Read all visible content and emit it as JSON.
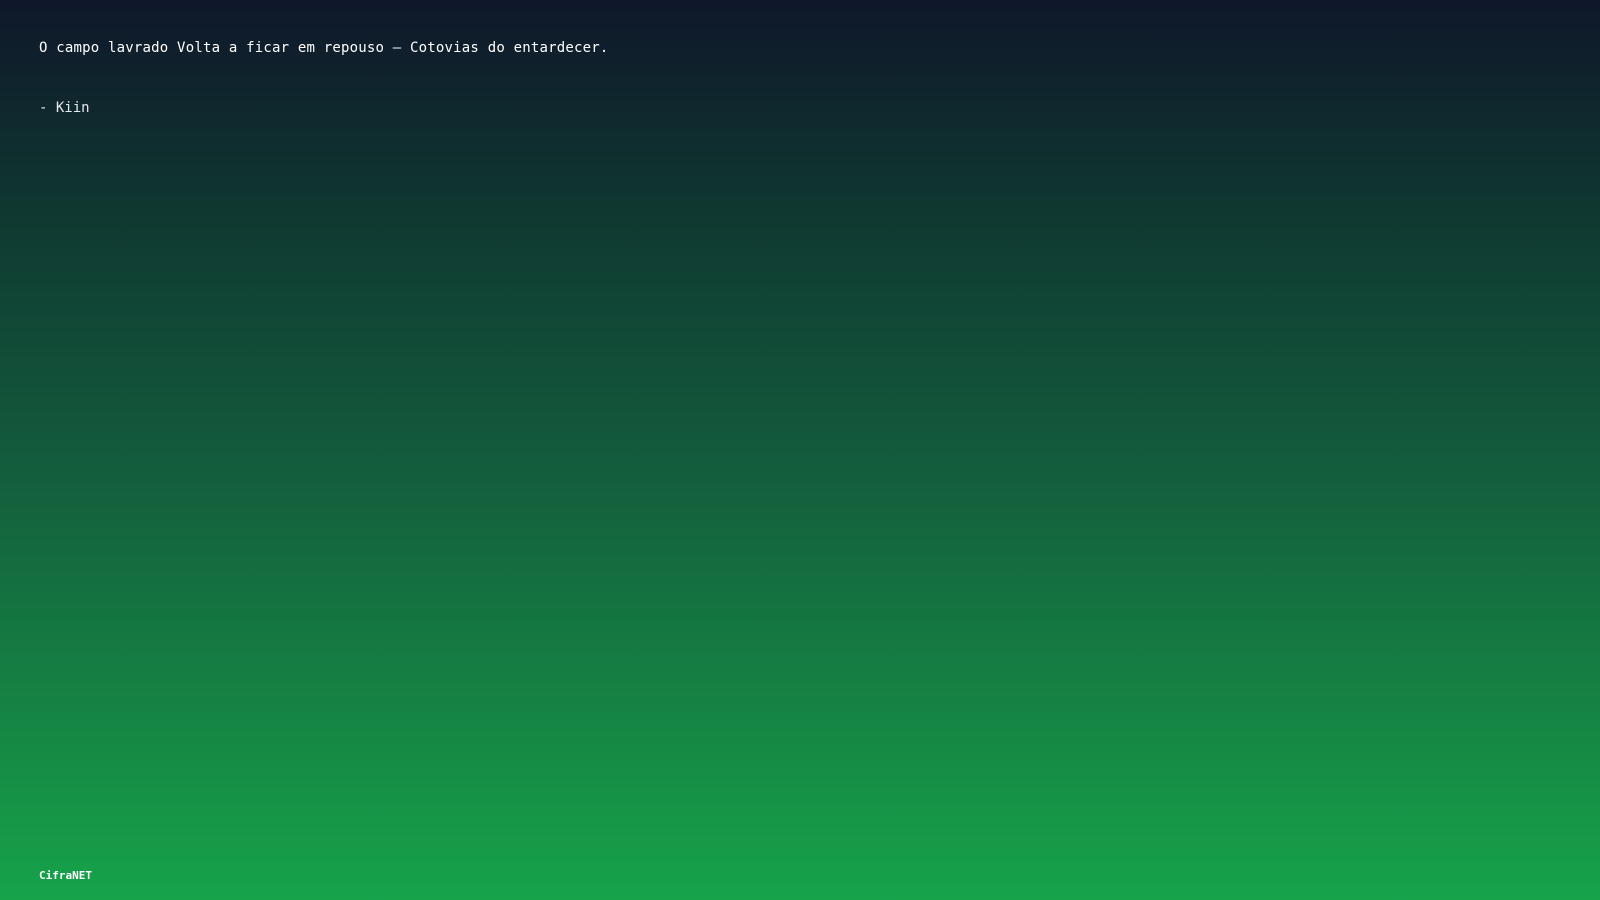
{
  "quote": {
    "text": "O campo lavrado Volta a ficar em repouso — Cotovias do entardecer.",
    "author": "- Kiin"
  },
  "footer": {
    "brand": "CifraNET"
  }
}
